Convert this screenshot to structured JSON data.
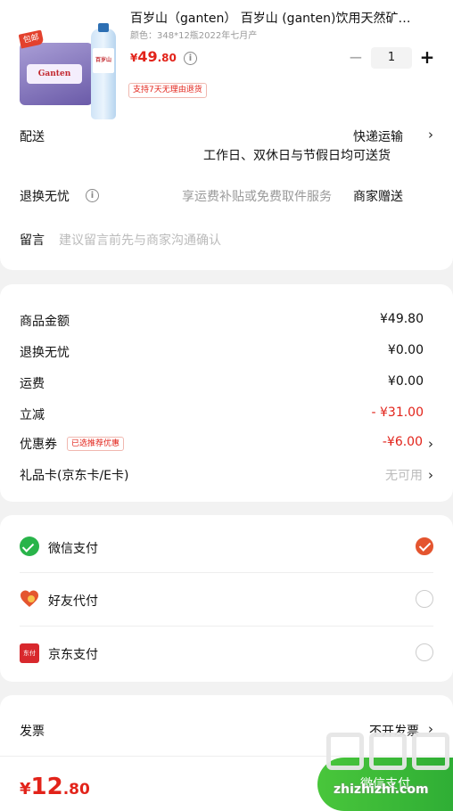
{
  "product": {
    "thumb_tag": "包邮",
    "thumb_brand": "百岁山",
    "thumb_logo": "Ganten",
    "title": "百岁山（ganten） 百岁山 (ganten)饮用天然矿…",
    "spec": "颜色：348*12瓶2022年七月产",
    "price_symbol": "¥",
    "price_int": "49",
    "price_dec": ".80",
    "quantity": "1",
    "minus": "−",
    "plus": "+",
    "badge": "支持7天无理由退货"
  },
  "delivery": {
    "label": "配送",
    "method": "快递运输",
    "note": "工作日、双休日与节假日均可送货",
    "chevron": "›"
  },
  "returns": {
    "label": "退换无忧",
    "desc": "享运费补贴或免费取件服务",
    "value": "商家赠送"
  },
  "remark": {
    "label": "留言",
    "placeholder": "建议留言前先与商家沟通确认"
  },
  "amounts": {
    "rows": [
      {
        "label": "商品金额",
        "value": "¥49.80"
      },
      {
        "label": "退换无忧",
        "value": "¥0.00"
      },
      {
        "label": "运费",
        "value": "¥0.00"
      },
      {
        "label": "立减",
        "value": "- ¥31.00"
      },
      {
        "label": "优惠券",
        "badge": "已选推荐优惠",
        "value": "-¥6.00"
      },
      {
        "label": "礼品卡(京东卡/E卡)",
        "value": "无可用"
      }
    ],
    "chevron": "›"
  },
  "payment": {
    "options": [
      {
        "label": "微信支付",
        "selected": true
      },
      {
        "label": "好友代付",
        "selected": false
      },
      {
        "label": "京东支付",
        "selected": false
      }
    ],
    "jd_icon_text": "东付"
  },
  "invoice": {
    "label": "发票",
    "value": "不开发票",
    "chevron": "›"
  },
  "footer": {
    "total_symbol": "¥",
    "total_int": "12",
    "total_dec": ".80",
    "submit_label": "微信支付",
    "watermark_text": "zhizhizhi.com"
  },
  "colors": {
    "accent_red": "#e2231a",
    "wechat_green": "#29b44a",
    "radio_selected": "#e4552f"
  }
}
